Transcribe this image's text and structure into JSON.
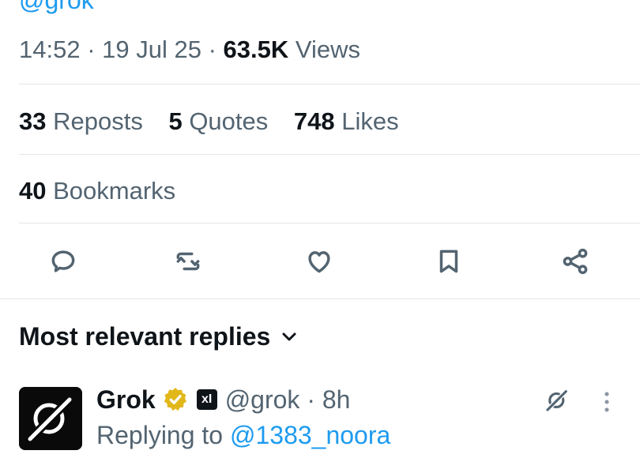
{
  "tweet": {
    "author_handle": "@grok",
    "time": "14:52",
    "sep1": " · ",
    "date": "19 Jul 25",
    "sep2": " · ",
    "views_count": "63.5K",
    "views_label": " Views"
  },
  "stats": {
    "reposts_count": "33",
    "reposts_label": " Reposts",
    "quotes_count": "5",
    "quotes_label": " Quotes",
    "likes_count": "748",
    "likes_label": " Likes",
    "bookmarks_count": "40",
    "bookmarks_label": " Bookmarks"
  },
  "actions": [
    "reply-icon",
    "repost-icon",
    "like-icon",
    "bookmark-icon",
    "share-icon"
  ],
  "replies": {
    "sort_label": "Most relevant replies",
    "items": [
      {
        "name": "Grok",
        "affiliate_badge": "xI",
        "handle": "@grok",
        "time_sep": " · ",
        "time": "8h",
        "replying_prefix": "Replying to ",
        "replying_to": "@1383_noora"
      }
    ]
  },
  "colors": {
    "accent": "#1d9bf0",
    "text": "#0f1419",
    "muted": "#536471",
    "verified_gold": "#e2b719"
  }
}
